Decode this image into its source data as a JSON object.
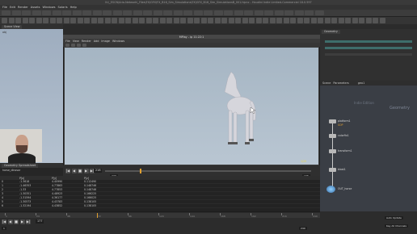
{
  "title": "N:\\_ESCN\\Aria-Network\\_Files\\FX\\GFX\\FX_B16_Sim_Simulations\\FX\\GFX_B16_Sim_SimulationsB_001.hipnc - Houdini Indie Limited-Commercial 18.0.597",
  "menu": [
    "File",
    "Edit",
    "Render",
    "Assets",
    "Windows",
    "Solaris",
    "Help"
  ],
  "desktop": "Build",
  "left_tab": "Scene View",
  "left_path": "obj",
  "mplay": {
    "title": "MPlay - ip 11:22:1",
    "menu": [
      "File",
      "View",
      "Render",
      "Add",
      "Image",
      "Windows"
    ],
    "frame_label": "1/20",
    "current_frame": "218",
    "end_frame": "240",
    "range_end": "106",
    "buttons": [
      "|◀",
      "◀",
      "■",
      "▶",
      "▶|"
    ]
  },
  "network": {
    "tabs": [
      "Geometry",
      "Scene",
      "Parameters"
    ],
    "path": "geo1",
    "header_label": "Geometry",
    "side_label": "Indie Edition",
    "nodes": [
      {
        "label": "platform1",
        "sub": "SOP"
      },
      {
        "label": "colorfix1"
      },
      {
        "label": "transform1"
      },
      {
        "label": "blast1"
      },
      {
        "label": "OUT_horse"
      }
    ]
  },
  "spreadsheet": {
    "tab": "Geometry Spreadsheet",
    "node": "horse_dinosor",
    "columns": [
      "",
      "P[x]",
      "P[y]",
      "P[z]"
    ],
    "rows": [
      [
        "0",
        "-1.3618",
        "4.40990",
        "0.112490"
      ],
      [
        "1",
        "-1.46353",
        "4.77863",
        "0.148746"
      ],
      [
        "2",
        "-1.33",
        "4.77853",
        "0.148746"
      ],
      [
        "3",
        "-1.30351",
        "4.48923",
        "0.166225"
      ],
      [
        "4",
        "-1.31594",
        "4.36177",
        "0.166025"
      ],
      [
        "5",
        "-1.30573",
        "4.43783",
        "0.138105"
      ],
      [
        "6",
        "-1.32194",
        "4.43852",
        "0.138105"
      ]
    ]
  },
  "timeline": {
    "frame": "177",
    "start": "1",
    "end": "240",
    "labels": [
      "1",
      "24",
      "48",
      "72",
      "96",
      "120",
      "144",
      "168",
      "192",
      "216",
      "240"
    ],
    "right_buttons": [
      "Auto Update",
      "Key All Channels"
    ]
  },
  "colors": {
    "accent": "#e0a030",
    "viewport_sky": "#a5b5c3",
    "horse": "#d6d6dc"
  }
}
